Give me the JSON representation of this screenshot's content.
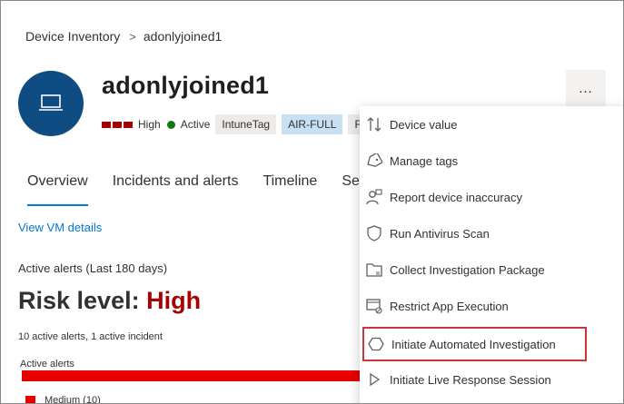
{
  "breadcrumb": {
    "root": "Device Inventory",
    "separator": ">",
    "current": "adonlyjoined1"
  },
  "device": {
    "name": "adonlyjoined1",
    "risk": "High",
    "health": "Active"
  },
  "tags": [
    "IntuneTag",
    "AIR-FULL",
    "Fu"
  ],
  "more_button": "…",
  "tabs": [
    "Overview",
    "Incidents and alerts",
    "Timeline",
    "Sec"
  ],
  "view_vm_link": "View VM details",
  "alerts": {
    "section_title": "Active alerts (Last 180 days)",
    "risk_prefix": "Risk level:",
    "risk_value": "High",
    "summary": "10 active alerts, 1 active incident",
    "bar_label": "Active alerts",
    "legend_medium": "Medium (10)"
  },
  "menu": {
    "items": [
      {
        "label": "Device value",
        "icon": "sort-arrows-icon"
      },
      {
        "label": "Manage tags",
        "icon": "tag-icon"
      },
      {
        "label": "Report device inaccuracy",
        "icon": "person-feedback-icon"
      },
      {
        "label": "Run Antivirus Scan",
        "icon": "shield-icon"
      },
      {
        "label": "Collect Investigation Package",
        "icon": "package-icon"
      },
      {
        "label": "Restrict App Execution",
        "icon": "restrict-app-icon"
      },
      {
        "label": "Initiate Automated Investigation",
        "icon": "hexagon-icon"
      },
      {
        "label": "Initiate Live Response Session",
        "icon": "play-icon"
      }
    ],
    "highlighted_index": 6
  },
  "colors": {
    "accent": "#0078d4",
    "risk_high": "#a80000",
    "alert_bar": "#e60000",
    "active": "#107c10",
    "highlight_border": "#d13438"
  }
}
